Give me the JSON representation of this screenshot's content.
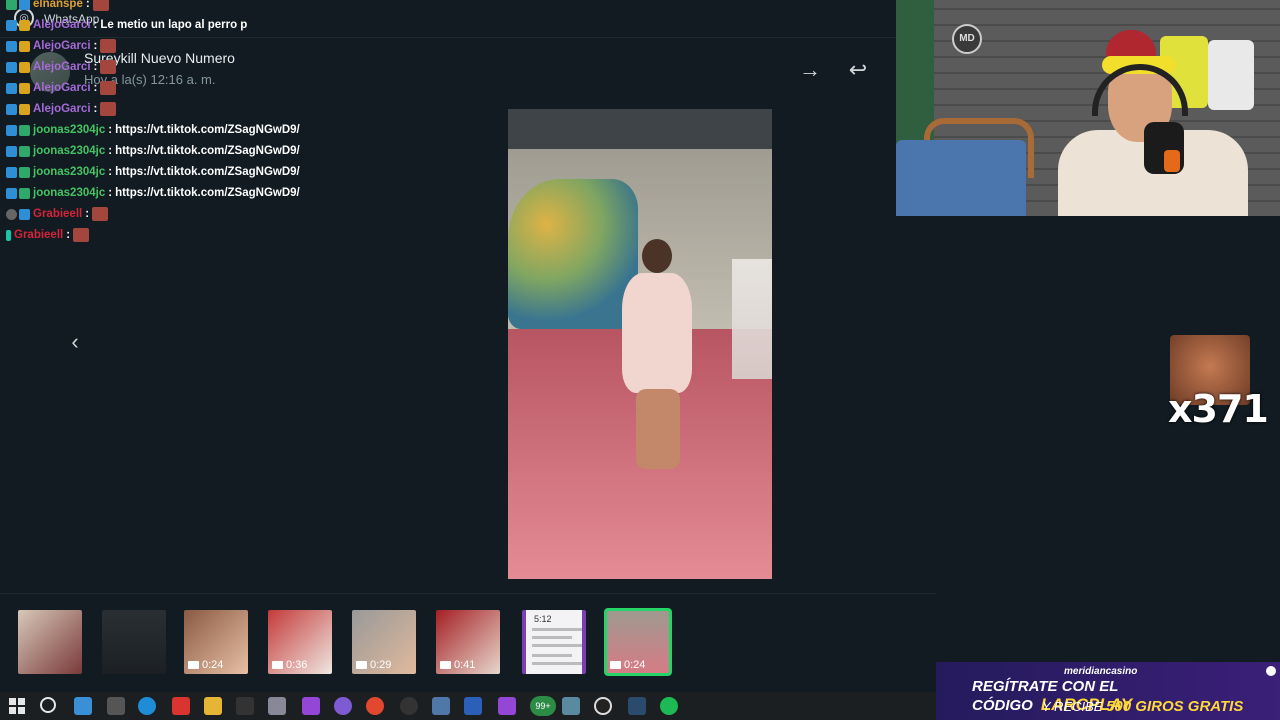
{
  "viewer": {
    "app_title": "WhatsApp",
    "contact_name": "Sureykill Nuevo Numero",
    "time": "Hoy a la(s) 12:16 a. m.",
    "forward_icon": "arrow-right-icon",
    "reply_icon": "reply-icon",
    "prev_icon": "chevron-left-icon"
  },
  "chat": [
    {
      "user": "elnanspe",
      "user_color": "#dfa035",
      "sep": ":",
      "msg": ""
    },
    {
      "user": "AlejoGarci",
      "user_color": "#a66ad9",
      "sep": ":",
      "msg": "Le metio un lapo al perro p"
    },
    {
      "user": "AlejoGarci",
      "user_color": "#a66ad9",
      "sep": ":",
      "msg": ""
    },
    {
      "user": "AlejoGarci",
      "user_color": "#a66ad9",
      "sep": ":",
      "msg": ""
    },
    {
      "user": "AlejoGarci",
      "user_color": "#a66ad9",
      "sep": ":",
      "msg": ""
    },
    {
      "user": "AlejoGarci",
      "user_color": "#a66ad9",
      "sep": ":",
      "msg": ""
    },
    {
      "user": "joonas2304jc",
      "user_color": "#43c463",
      "sep": ":",
      "msg": "https://vt.tiktok.com/ZSagNGwD9/"
    },
    {
      "user": "joonas2304jc",
      "user_color": "#43c463",
      "sep": ":",
      "msg": "https://vt.tiktok.com/ZSagNGwD9/"
    },
    {
      "user": "joonas2304jc",
      "user_color": "#43c463",
      "sep": ":",
      "msg": "https://vt.tiktok.com/ZSagNGwD9/"
    },
    {
      "user": "joonas2304jc",
      "user_color": "#43c463",
      "sep": ":",
      "msg": "https://vt.tiktok.com/ZSagNGwD9/"
    },
    {
      "user": "Grabieell",
      "user_color": "#d4243a",
      "sep": ":",
      "msg": ""
    },
    {
      "user": "Grabieell",
      "user_color": "#d4243a",
      "sep": ":",
      "msg": ""
    }
  ],
  "thumbnails": [
    {
      "duration": "",
      "kind": "photo"
    },
    {
      "duration": "",
      "kind": "text"
    },
    {
      "duration": "0:24",
      "kind": "video"
    },
    {
      "duration": "0:36",
      "kind": "video"
    },
    {
      "duration": "0:29",
      "kind": "video"
    },
    {
      "duration": "0:41",
      "kind": "video"
    },
    {
      "duration": "",
      "kind": "doc",
      "doc_number": "5:12"
    },
    {
      "duration": "0:24",
      "kind": "video",
      "selected": true
    }
  ],
  "overlay": {
    "emote_count": "x371"
  },
  "ad": {
    "brand": "meridiancasino",
    "line1": "REGÍTRATE CON EL CÓDIGO",
    "code": "LARCPLAY",
    "line2_prefix": "Y RECIBE",
    "line2_highlight": "500 GIROS GRATIS"
  },
  "taskbar": {
    "notification_badge": "99+"
  },
  "colors": {
    "accent": "#25d366",
    "background": "#111b21"
  }
}
